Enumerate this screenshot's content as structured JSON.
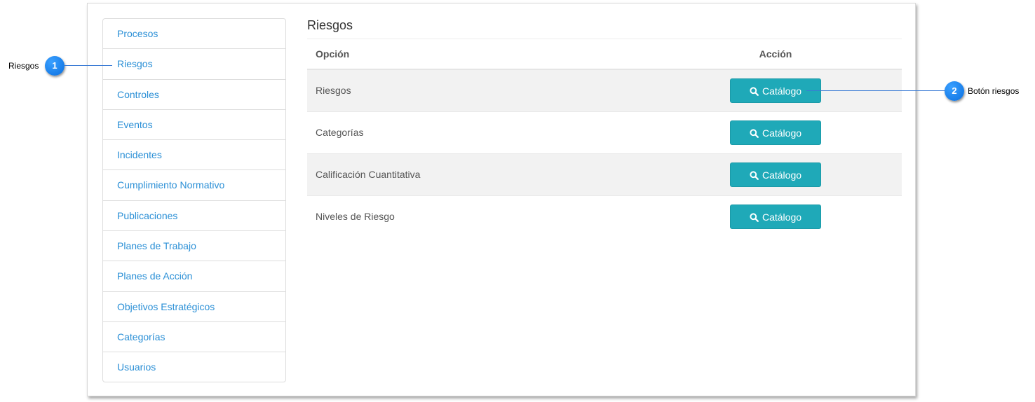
{
  "sidebar": {
    "items": [
      {
        "label": "Procesos"
      },
      {
        "label": "Riesgos"
      },
      {
        "label": "Controles"
      },
      {
        "label": "Eventos"
      },
      {
        "label": "Incidentes"
      },
      {
        "label": "Cumplimiento Normativo"
      },
      {
        "label": "Publicaciones"
      },
      {
        "label": "Planes de Trabajo"
      },
      {
        "label": "Planes de Acción"
      },
      {
        "label": "Objetivos Estratégicos"
      },
      {
        "label": "Categorías"
      },
      {
        "label": "Usuarios"
      }
    ]
  },
  "main": {
    "title": "Riesgos",
    "columns": {
      "option": "Opción",
      "action": "Acción"
    },
    "rows": [
      {
        "option": "Riesgos",
        "button": "Catálogo"
      },
      {
        "option": "Categorías",
        "button": "Catálogo"
      },
      {
        "option": "Calificación Cuantitativa",
        "button": "Catálogo"
      },
      {
        "option": "Niveles de Riesgo",
        "button": "Catálogo"
      }
    ]
  },
  "callouts": [
    {
      "number": "1",
      "label": "Riesgos"
    },
    {
      "number": "2",
      "label": "Botón riesgos"
    }
  ],
  "colors": {
    "link": "#2a8fd6",
    "button": "#1fa9b8",
    "callout": "#0a6fe0"
  },
  "icons": {
    "button_icon": "search-icon"
  }
}
